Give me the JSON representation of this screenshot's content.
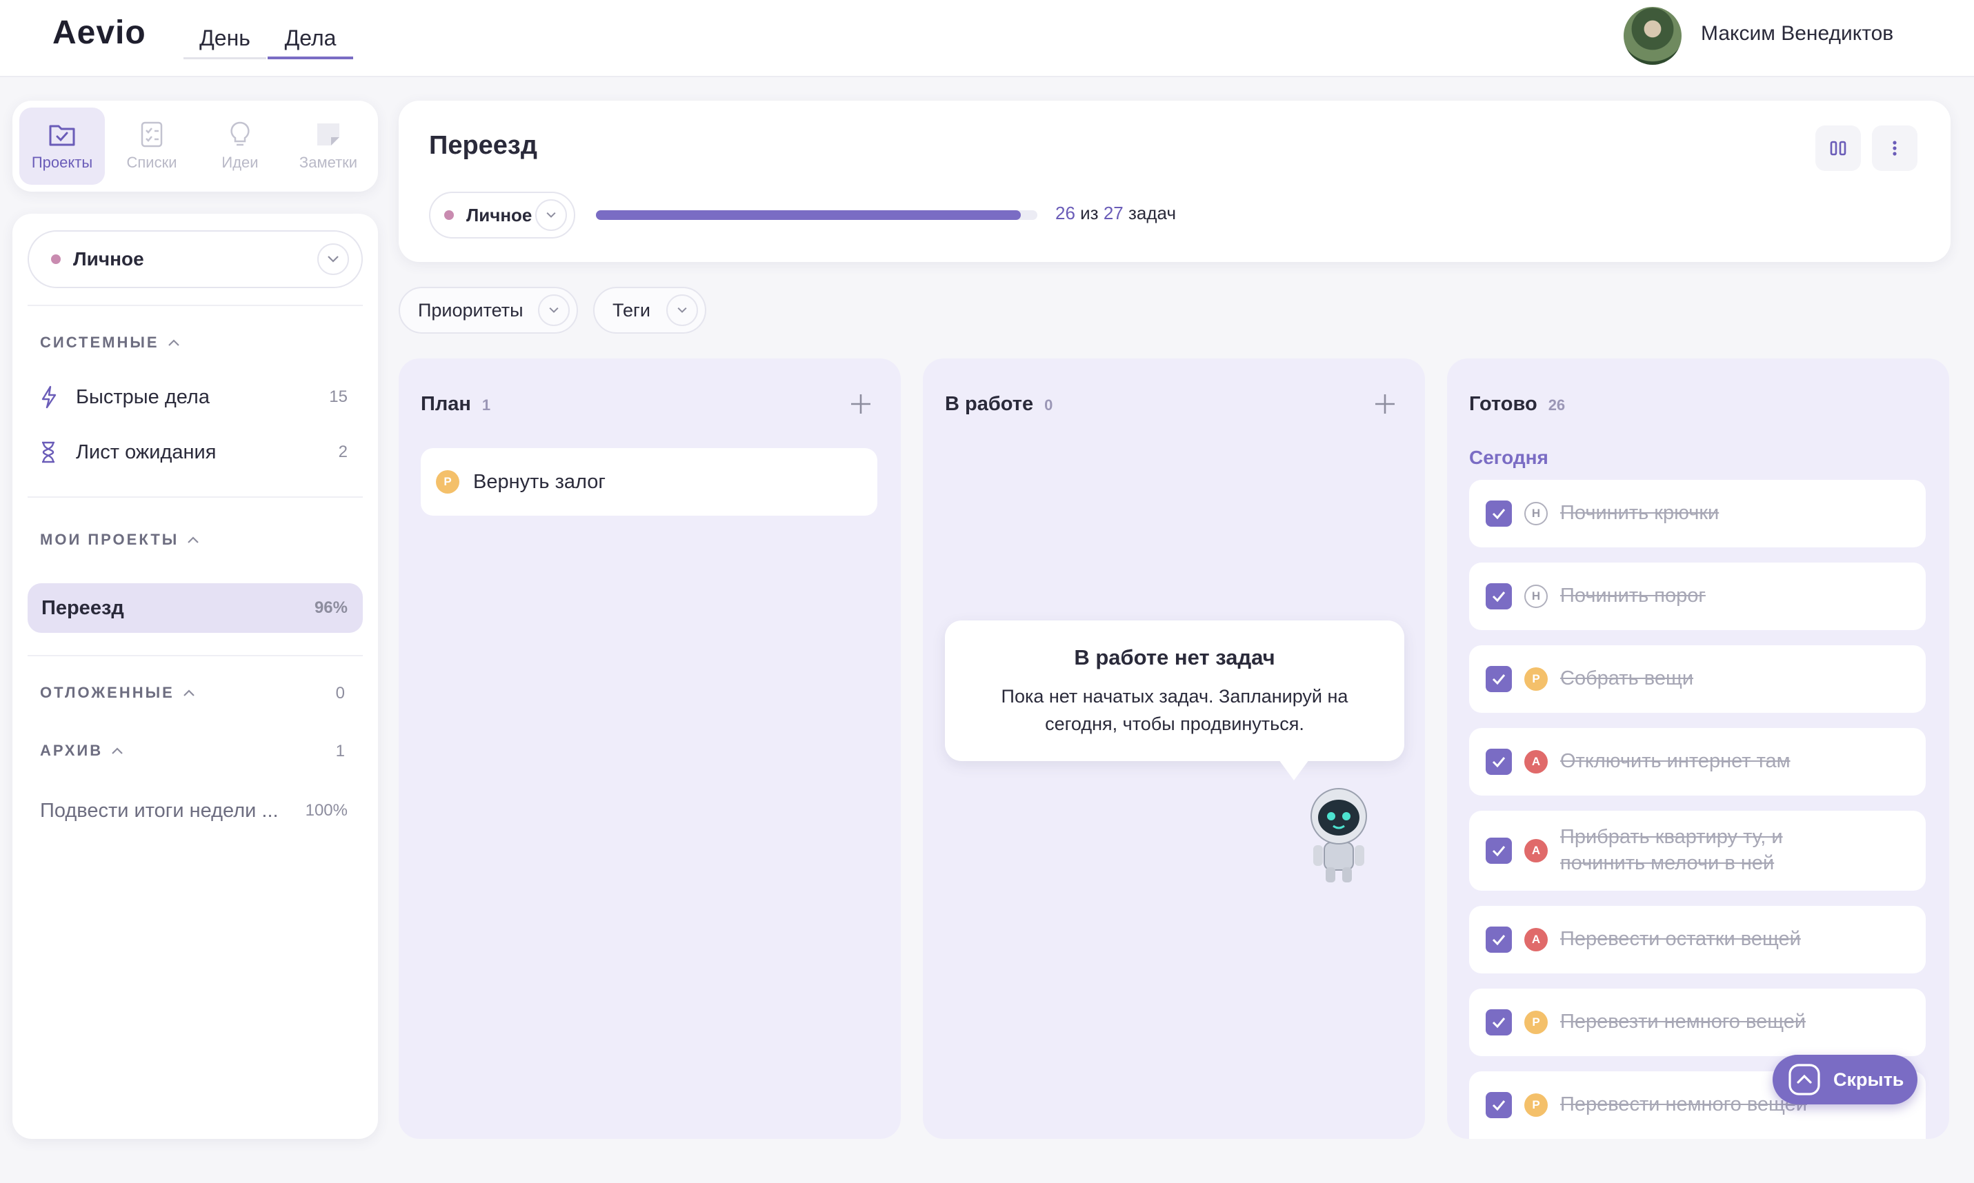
{
  "header": {
    "logo": "Aevio",
    "nav": [
      {
        "label": "День"
      },
      {
        "label": "Дела"
      }
    ],
    "user_name": "Максим Венедиктов"
  },
  "switcher": [
    {
      "label": "Проекты",
      "icon": "folder-check-icon"
    },
    {
      "label": "Списки",
      "icon": "checklist-icon"
    },
    {
      "label": "Идеи",
      "icon": "lightbulb-icon"
    },
    {
      "label": "Заметки",
      "icon": "note-icon"
    }
  ],
  "sidebar": {
    "space": "Личное",
    "system_label": "СИСТЕМНЫЕ",
    "system_items": [
      {
        "label": "Быстрые дела",
        "count": "15",
        "icon": "lightning-icon"
      },
      {
        "label": "Лист ожидания",
        "count": "2",
        "icon": "hourglass-icon"
      }
    ],
    "projects_label": "МОИ ПРОЕКТЫ",
    "projects": [
      {
        "label": "Переезд",
        "percent": "96%"
      }
    ],
    "postponed_label": "ОТЛОЖЕННЫЕ",
    "postponed_count": "0",
    "archive_label": "АРХИВ",
    "archive_count": "1",
    "archive_items": [
      {
        "label": "Подвести итоги недели ...",
        "percent": "100%"
      }
    ]
  },
  "project": {
    "title": "Переезд",
    "tag": "Личное",
    "progress": {
      "done": "26",
      "of": "из",
      "total": "27",
      "unit": "задач",
      "fraction": 0.963
    }
  },
  "filters": [
    {
      "label": "Приоритеты"
    },
    {
      "label": "Теги"
    }
  ],
  "columns": {
    "plan": {
      "title": "План",
      "count": "1",
      "tasks": [
        {
          "label": "Вернуть залог",
          "prio": "Р"
        }
      ]
    },
    "inwork": {
      "title": "В работе",
      "count": "0",
      "empty_title": "В работе нет задач",
      "empty_text": "Пока нет начатых задач. Запланируй на сегодня, чтобы продвинуться."
    },
    "done": {
      "title": "Готово",
      "count": "26",
      "group": "Сегодня",
      "tasks": [
        {
          "label": "Починить крючки",
          "prio": "Н"
        },
        {
          "label": "Починить порог",
          "prio": "Н"
        },
        {
          "label": "Собрать вещи",
          "prio": "Р"
        },
        {
          "label": "Отключить интернет там",
          "prio": "А"
        },
        {
          "label": "Прибрать квартиру ту, и починить мелочи в ней",
          "prio": "А"
        },
        {
          "label": "Перевести остатки вещей",
          "prio": "А"
        },
        {
          "label": "Перевезти немного вещей",
          "prio": "Р"
        },
        {
          "label": "Перевести немного вещей",
          "prio": "Р"
        }
      ]
    }
  },
  "hide_button": "Скрыть",
  "colors": {
    "accent": "#7a6cc4",
    "space_dot": "#c98bb0",
    "prio_p": "#f4c06a",
    "prio_a": "#e06a6a"
  }
}
